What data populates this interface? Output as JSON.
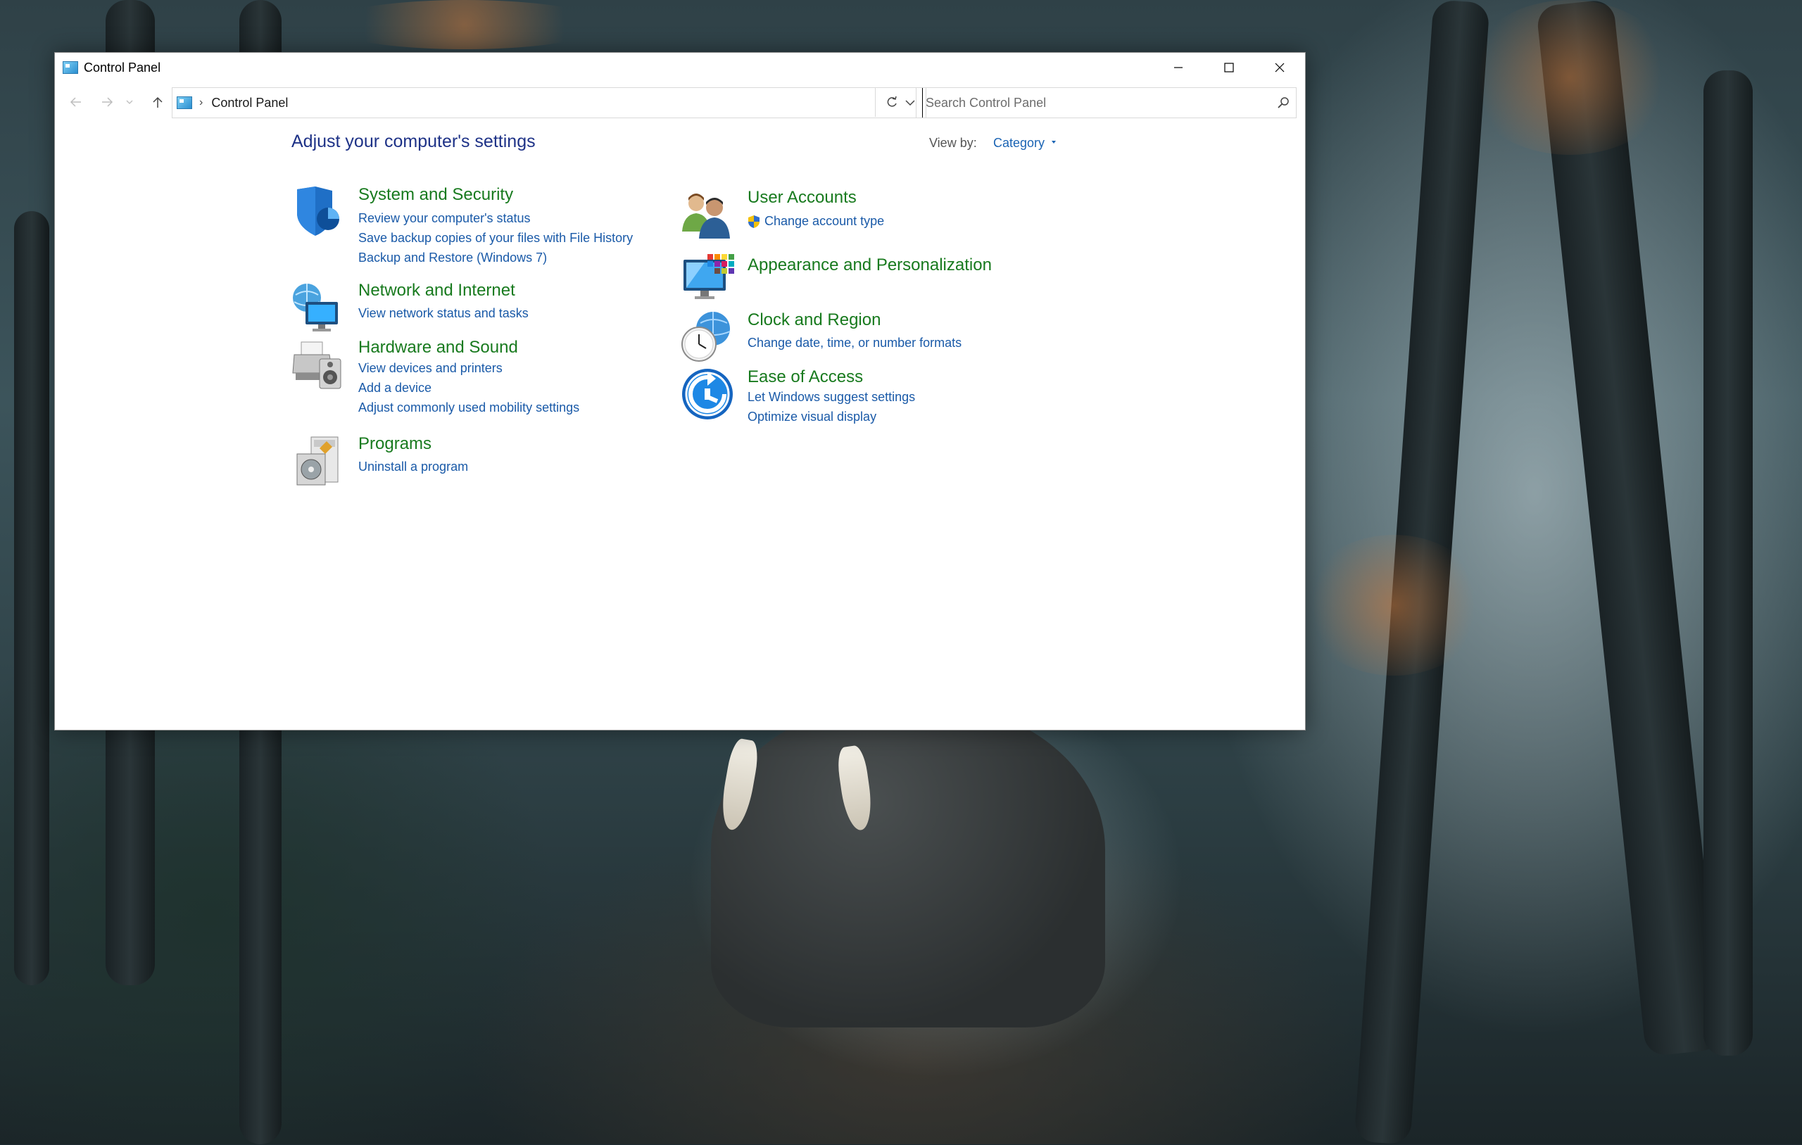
{
  "window": {
    "title": "Control Panel",
    "controls": {
      "minimize": "minimize-icon",
      "maximize": "maximize-icon",
      "close": "close-icon"
    }
  },
  "navigation": {
    "back": "back-arrow-icon",
    "forward": "forward-arrow-icon",
    "recent": "chevron-down-icon",
    "up": "up-arrow-icon",
    "breadcrumb": [
      "Control Panel"
    ],
    "search_placeholder": "Search Control Panel"
  },
  "main": {
    "heading": "Adjust your computer's settings",
    "view_by_label": "View by:",
    "view_by_value": "Category",
    "categories_left": [
      {
        "title": "System and Security",
        "icon": "shield-icon",
        "links": [
          "Review your computer's status",
          "Save backup copies of your files with File History",
          "Backup and Restore (Windows 7)"
        ]
      },
      {
        "title": "Network and Internet",
        "icon": "network-icon",
        "links": [
          "View network status and tasks"
        ]
      },
      {
        "title": "Hardware and Sound",
        "icon": "printer-speaker-icon",
        "links": [
          "View devices and printers",
          "Add a device",
          "Adjust commonly used mobility settings"
        ]
      },
      {
        "title": "Programs",
        "icon": "programs-icon",
        "links": [
          "Uninstall a program"
        ]
      }
    ],
    "categories_right": [
      {
        "title": "User Accounts",
        "icon": "users-icon",
        "links": [
          "Change account type"
        ]
      },
      {
        "title": "Appearance and Personalization",
        "icon": "monitor-palette-icon",
        "links": []
      },
      {
        "title": "Clock and Region",
        "icon": "clock-globe-icon",
        "links": [
          "Change date, time, or number formats"
        ]
      },
      {
        "title": "Ease of Access",
        "icon": "ease-of-access-icon",
        "links": [
          "Let Windows suggest settings",
          "Optimize visual display"
        ]
      }
    ]
  },
  "colors": {
    "category_title": "#187a1e",
    "link": "#1a5aa8",
    "heading": "#1e3287"
  }
}
